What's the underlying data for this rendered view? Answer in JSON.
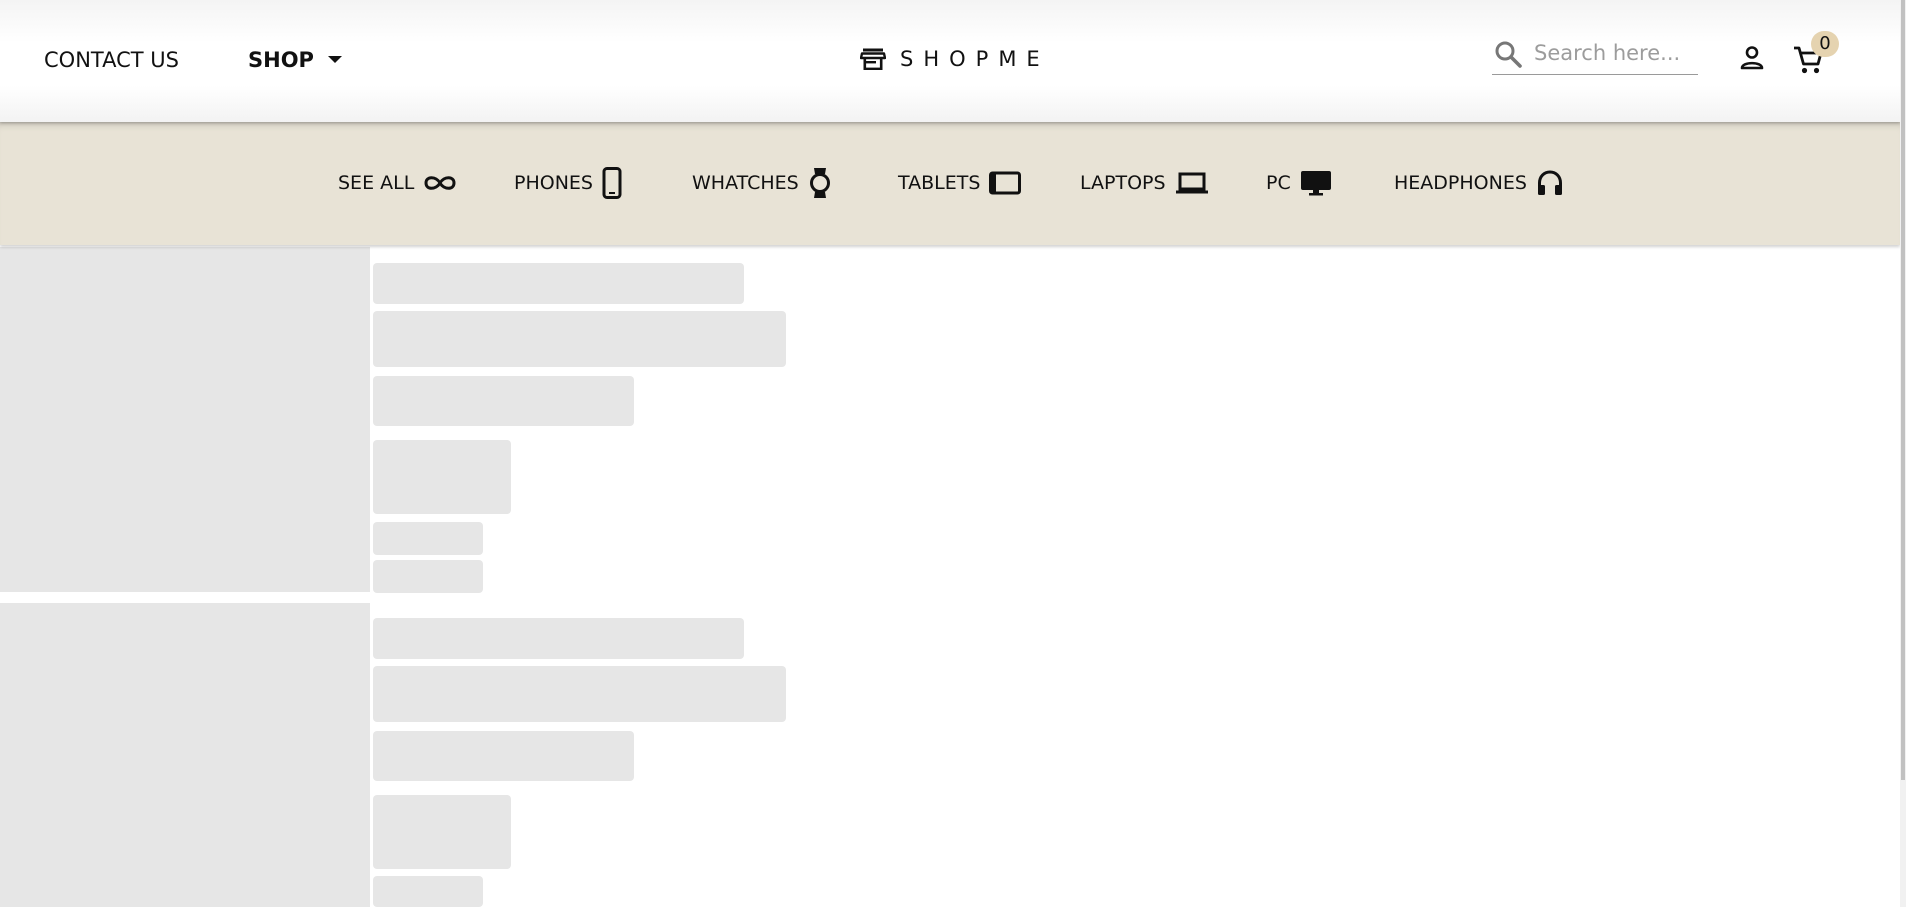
{
  "header": {
    "contact_label": "CONTACT US",
    "shop_label": "SHOP",
    "logo_text": "SHOPME",
    "search_placeholder": "Search here...",
    "cart_count": "0",
    "badge_color": "#e5d3b0"
  },
  "categories": [
    {
      "label": "SEE ALL",
      "icon": "infinity-icon"
    },
    {
      "label": "PHONES",
      "icon": "phone-icon"
    },
    {
      "label": "WHATCHES",
      "icon": "watch-icon"
    },
    {
      "label": "TABLETS",
      "icon": "tablet-icon"
    },
    {
      "label": "LAPTOPS",
      "icon": "laptop-icon"
    },
    {
      "label": "PC",
      "icon": "monitor-icon"
    },
    {
      "label": "HEADPHONES",
      "icon": "headphones-icon"
    }
  ],
  "colors": {
    "category_bar": "#e8e3d6",
    "skeleton": "#e6e6e6"
  }
}
